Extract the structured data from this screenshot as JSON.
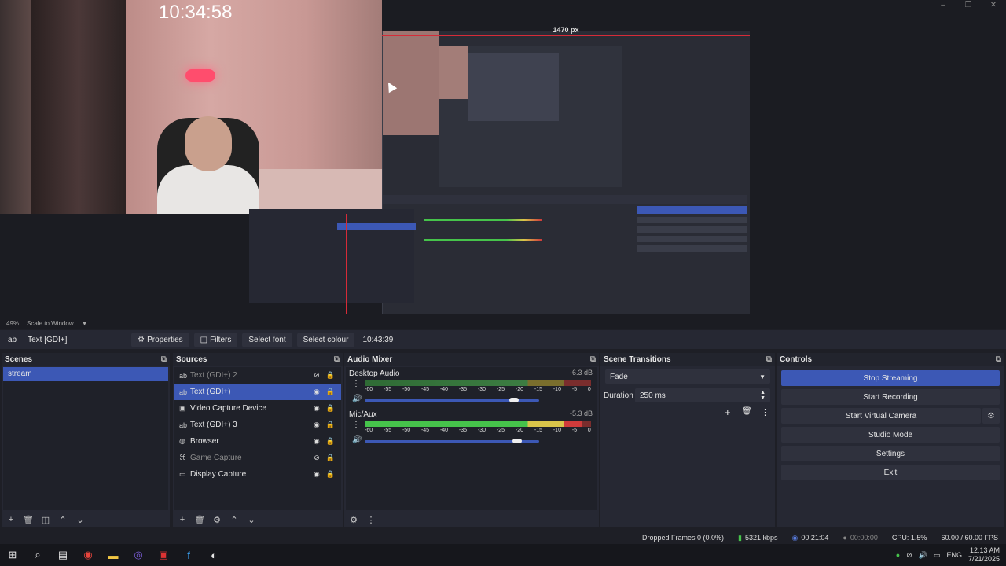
{
  "preview": {
    "webcam_clock": "10:34:58",
    "nested_title": "1470 px",
    "window_controls": [
      "–",
      "❐",
      "✕"
    ]
  },
  "zoom": {
    "level": "49%",
    "mode": "Scale to Window"
  },
  "toolbar": {
    "source_name": "Text [GDI+]",
    "properties": "Properties",
    "filters": "Filters",
    "select_font": "Select font",
    "select_colour": "Select colour",
    "time_text": "10:43:39"
  },
  "scenes": {
    "title": "Scenes",
    "items": [
      "stream"
    ]
  },
  "sources": {
    "title": "Sources",
    "items": [
      {
        "label": "Text (GDI+) 2",
        "icon": "ab",
        "visible": false
      },
      {
        "label": "Text (GDI+)",
        "icon": "ab",
        "visible": true,
        "selected": true
      },
      {
        "label": "Video Capture Device",
        "icon": "camera",
        "visible": true
      },
      {
        "label": "Text (GDI+) 3",
        "icon": "ab",
        "visible": true
      },
      {
        "label": "Browser",
        "icon": "globe",
        "visible": true
      },
      {
        "label": "Game Capture",
        "icon": "gamepad",
        "visible": false
      },
      {
        "label": "Display Capture",
        "icon": "monitor",
        "visible": true
      }
    ]
  },
  "mixer": {
    "title": "Audio Mixer",
    "channels": [
      {
        "name": "Desktop Audio",
        "db": "-6.3 dB",
        "volume_fraction": 0.84
      },
      {
        "name": "Mic/Aux",
        "db": "-5.3 dB",
        "volume_fraction": 0.86
      }
    ],
    "ticks": [
      "-60",
      "-55",
      "-50",
      "-45",
      "-40",
      "-35",
      "-30",
      "-25",
      "-20",
      "-15",
      "-10",
      "-5",
      "0"
    ]
  },
  "transitions": {
    "title": "Scene Transitions",
    "type": "Fade",
    "duration_label": "Duration",
    "duration": "250 ms"
  },
  "controls": {
    "title": "Controls",
    "stop_streaming": "Stop Streaming",
    "start_recording": "Start Recording",
    "virtual_camera": "Start Virtual Camera",
    "studio_mode": "Studio Mode",
    "settings": "Settings",
    "exit": "Exit"
  },
  "status": {
    "dropped": "Dropped Frames 0 (0.0%)",
    "kbps": "5321 kbps",
    "stream_time": "00:21:04",
    "rec_time": "00:00:00",
    "cpu": "CPU: 1.5%",
    "fps": "60.00 / 60.00 FPS"
  },
  "taskbar": {
    "lang": "ENG",
    "time": "12:13 AM",
    "date": "7/21/2025"
  },
  "colors": {
    "accent": "#3c58b5",
    "record_red": "#d62b38",
    "meter_green": "#46c34b"
  }
}
